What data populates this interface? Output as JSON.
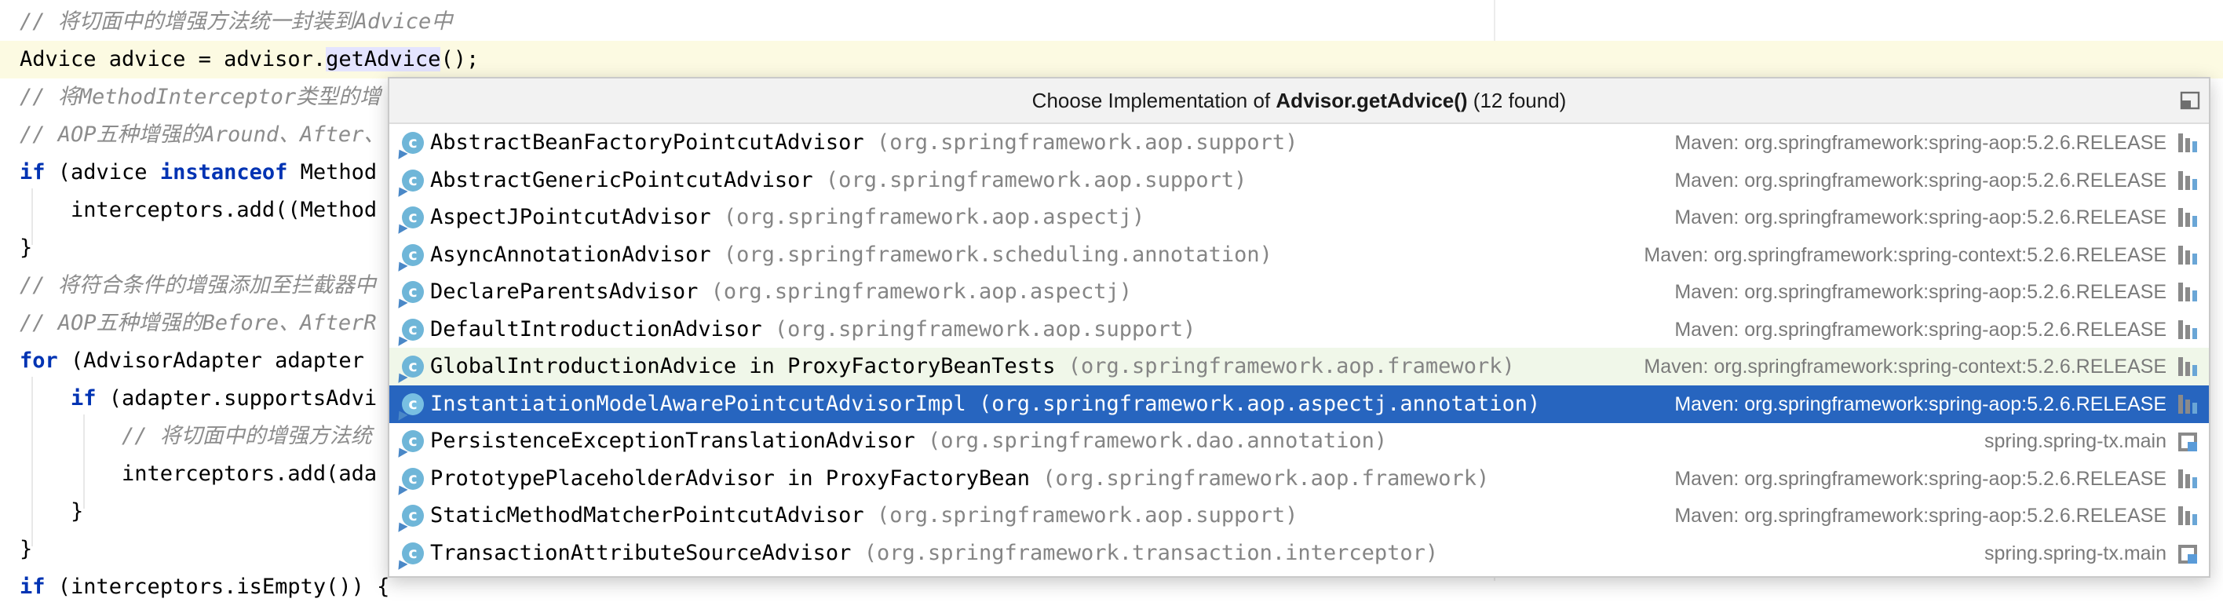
{
  "editor": {
    "lines": [
      {
        "parts": [
          {
            "t": "// 将切面中的增强方法统一封装到",
            "c": "cm"
          },
          {
            "t": "Advice",
            "c": "cm"
          },
          {
            "t": "中",
            "c": "cm"
          }
        ]
      },
      {
        "parts": [
          {
            "t": "Advice advice = advisor.",
            "c": ""
          },
          {
            "t": "getAdvice",
            "c": "hl"
          },
          {
            "t": "();",
            "c": ""
          }
        ]
      },
      {
        "parts": [
          {
            "t": "// 将",
            "c": "cm"
          },
          {
            "t": "MethodInterceptor",
            "c": "cm"
          },
          {
            "t": "类型的增",
            "c": "cm"
          }
        ]
      },
      {
        "parts": [
          {
            "t": "// AOP五种增强的",
            "c": "cm"
          },
          {
            "t": "Around",
            "c": "cm"
          },
          {
            "t": "、",
            "c": "cm"
          },
          {
            "t": "After",
            "c": "cm"
          },
          {
            "t": "、",
            "c": "cm"
          }
        ]
      },
      {
        "parts": [
          {
            "t": "if",
            "c": "kw"
          },
          {
            "t": " (advice ",
            "c": ""
          },
          {
            "t": "instanceof",
            "c": "kw"
          },
          {
            "t": " Method",
            "c": ""
          }
        ]
      },
      {
        "parts": [
          {
            "t": "    interceptors.add((Method",
            "c": ""
          }
        ]
      },
      {
        "parts": [
          {
            "t": "}",
            "c": ""
          }
        ]
      },
      {
        "parts": [
          {
            "t": "// 将符合条件的增强添加至拦截器中",
            "c": "cm"
          }
        ]
      },
      {
        "parts": [
          {
            "t": "// AOP五种增强的",
            "c": "cm"
          },
          {
            "t": "Before",
            "c": "cm"
          },
          {
            "t": "、",
            "c": "cm"
          },
          {
            "t": "AfterR",
            "c": "cm"
          }
        ]
      },
      {
        "parts": [
          {
            "t": "for",
            "c": "kw"
          },
          {
            "t": " (AdvisorAdapter adapter",
            "c": ""
          }
        ]
      },
      {
        "parts": [
          {
            "t": "    ",
            "c": ""
          },
          {
            "t": "if",
            "c": "kw"
          },
          {
            "t": " (adapter.supportsAdvi",
            "c": ""
          }
        ]
      },
      {
        "parts": [
          {
            "t": "        // 将切面中的增强方法统",
            "c": "cm"
          }
        ]
      },
      {
        "parts": [
          {
            "t": "        interceptors.add(ada",
            "c": ""
          }
        ]
      },
      {
        "parts": [
          {
            "t": "    }",
            "c": ""
          }
        ]
      },
      {
        "parts": [
          {
            "t": "}",
            "c": ""
          }
        ]
      },
      {
        "parts": [
          {
            "t": "if",
            "c": "kw"
          },
          {
            "t": " (interceptors.isEmpty()) {",
            "c": ""
          }
        ]
      }
    ]
  },
  "popup": {
    "title_prefix": "Choose Implementation of ",
    "title_method": "Advisor.getAdvice()",
    "title_suffix": " (12 found)",
    "pin_icon": "pin-window-icon",
    "items": [
      {
        "name": "AbstractBeanFactoryPointcutAdvisor",
        "package": "(org.springframework.aop.support)",
        "location": "Maven: org.springframework:spring-aop:5.2.6.RELEASE",
        "loc_icon": "library-icon",
        "style": ""
      },
      {
        "name": "AbstractGenericPointcutAdvisor",
        "package": "(org.springframework.aop.support)",
        "location": "Maven: org.springframework:spring-aop:5.2.6.RELEASE",
        "loc_icon": "library-icon",
        "style": ""
      },
      {
        "name": "AspectJPointcutAdvisor",
        "package": "(org.springframework.aop.aspectj)",
        "location": "Maven: org.springframework:spring-aop:5.2.6.RELEASE",
        "loc_icon": "library-icon",
        "style": ""
      },
      {
        "name": "AsyncAnnotationAdvisor",
        "package": "(org.springframework.scheduling.annotation)",
        "location": "Maven: org.springframework:spring-context:5.2.6.RELEASE",
        "loc_icon": "library-icon",
        "style": ""
      },
      {
        "name": "DeclareParentsAdvisor",
        "package": "(org.springframework.aop.aspectj)",
        "location": "Maven: org.springframework:spring-aop:5.2.6.RELEASE",
        "loc_icon": "library-icon",
        "style": ""
      },
      {
        "name": "DefaultIntroductionAdvisor",
        "package": "(org.springframework.aop.support)",
        "location": "Maven: org.springframework:spring-aop:5.2.6.RELEASE",
        "loc_icon": "library-icon",
        "style": ""
      },
      {
        "name": "GlobalIntroductionAdvice in ProxyFactoryBeanTests",
        "package": "(org.springframework.aop.framework)",
        "location": "Maven: org.springframework:spring-context:5.2.6.RELEASE",
        "loc_icon": "library-icon",
        "style": "alt"
      },
      {
        "name": "InstantiationModelAwarePointcutAdvisorImpl",
        "package": "(org.springframework.aop.aspectj.annotation)",
        "location": "Maven: org.springframework:spring-aop:5.2.6.RELEASE",
        "loc_icon": "library-icon",
        "style": "selected"
      },
      {
        "name": "PersistenceExceptionTranslationAdvisor",
        "package": "(org.springframework.dao.annotation)",
        "location": "spring.spring-tx.main",
        "loc_icon": "module-icon",
        "style": ""
      },
      {
        "name": "PrototypePlaceholderAdvisor in ProxyFactoryBean",
        "package": "(org.springframework.aop.framework)",
        "location": "Maven: org.springframework:spring-aop:5.2.6.RELEASE",
        "loc_icon": "library-icon",
        "style": ""
      },
      {
        "name": "StaticMethodMatcherPointcutAdvisor",
        "package": "(org.springframework.aop.support)",
        "location": "Maven: org.springframework:spring-aop:5.2.6.RELEASE",
        "loc_icon": "library-icon",
        "style": ""
      },
      {
        "name": "TransactionAttributeSourceAdvisor",
        "package": "(org.springframework.transaction.interceptor)",
        "location": "spring.spring-tx.main",
        "loc_icon": "module-icon",
        "style": ""
      }
    ]
  },
  "colors": {
    "selection": "#2765bf",
    "current_line": "#fcfae2",
    "keyword": "#0033b3",
    "comment": "#8c8c8c",
    "class_icon": "#6fb6d8"
  }
}
